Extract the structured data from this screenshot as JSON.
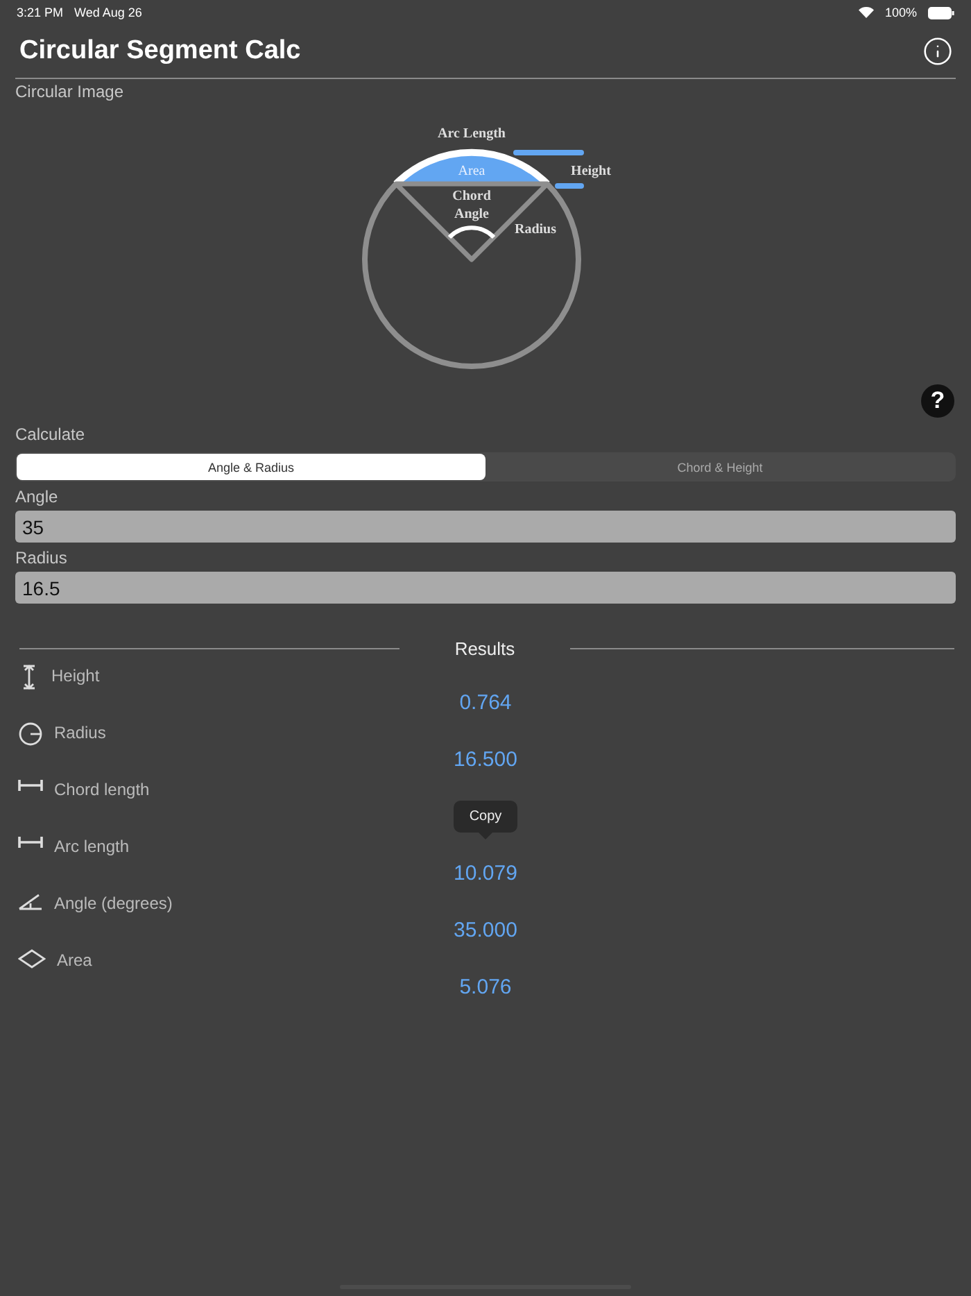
{
  "status_bar": {
    "time": "3:21 PM",
    "date": "Wed Aug 26",
    "battery": "100%"
  },
  "header": {
    "title": "Circular Segment Calc"
  },
  "image_section": {
    "label": "Circular Image",
    "diagram_labels": {
      "arc_length": "Arc Length",
      "area": "Area",
      "height": "Height",
      "chord": "Chord",
      "angle": "Angle",
      "radius": "Radius"
    }
  },
  "help_button": {
    "label": "?"
  },
  "calculate": {
    "label": "Calculate",
    "segments": [
      {
        "label": "Angle & Radius",
        "selected": true
      },
      {
        "label": "Chord & Height",
        "selected": false
      }
    ]
  },
  "fields": [
    {
      "label": "Angle",
      "value": "35"
    },
    {
      "label": "Radius",
      "value": "16.5"
    }
  ],
  "results": {
    "title": "Results",
    "rows": [
      {
        "kind": "height",
        "label": "Height",
        "value": "0.764"
      },
      {
        "kind": "radius",
        "label": "Radius",
        "value": "16.500"
      },
      {
        "kind": "chord",
        "label": "Chord length",
        "tooltip": "Copy"
      },
      {
        "kind": "arc",
        "label": "Arc length",
        "value": "10.079"
      },
      {
        "kind": "angle",
        "label": "Angle (degrees)",
        "value": "35.000"
      },
      {
        "kind": "area",
        "label": "Area",
        "value": "5.076"
      }
    ]
  }
}
